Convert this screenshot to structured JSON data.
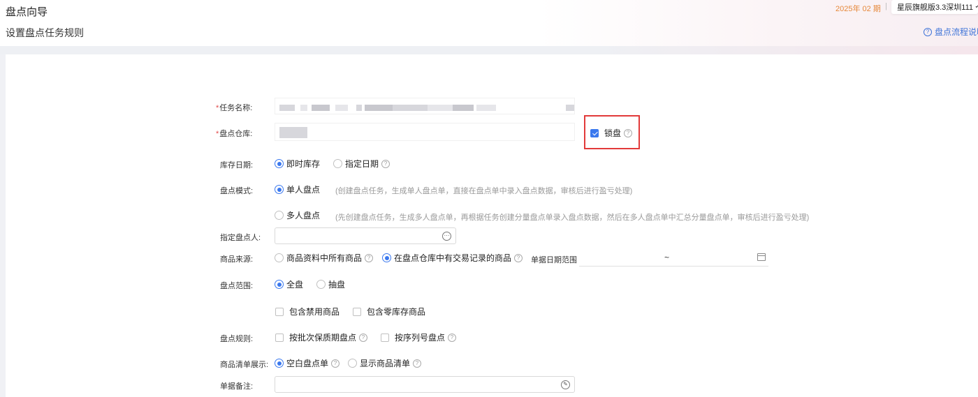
{
  "header": {
    "title": "盘点向导",
    "subtitle": "设置盘点任务规则",
    "period": "2025年 02 期",
    "separator": "|",
    "store": "星辰旗舰版3.3深圳111",
    "help_link": "盘点流程说明"
  },
  "form": {
    "task_name": {
      "label": "任务名称:",
      "required": "*"
    },
    "warehouse": {
      "label": "盘点仓库:",
      "required": "*",
      "lock_label": "锁盘",
      "lock_checked": true
    },
    "stock_date": {
      "label": "库存日期:",
      "options": [
        "即时库存",
        "指定日期"
      ],
      "selected": 0
    },
    "mode": {
      "label": "盘点模式:",
      "single": {
        "label": "单人盘点",
        "hint": "(创建盘点任务，生成单人盘点单，直接在盘点单中录入盘点数据，审核后进行盈亏处理)",
        "selected": true
      },
      "multi": {
        "label": "多人盘点",
        "hint": "(先创建盘点任务，生成多人盘点单，再根据任务创建分量盘点单录入盘点数据，然后在多人盘点单中汇总分量盘点单，审核后进行盈亏处理)",
        "selected": false
      }
    },
    "counter": {
      "label": "指定盘点人:",
      "value": ""
    },
    "source": {
      "label": "商品来源:",
      "options": [
        "商品资料中所有商品",
        "在盘点仓库中有交易记录的商品"
      ],
      "selected": 1,
      "date_range_label": "单据日期范围",
      "date_range_sep": "~"
    },
    "scope": {
      "label": "盘点范围:",
      "options": [
        "全盘",
        "抽盘"
      ],
      "selected": 0,
      "include_disabled": "包含禁用商品",
      "include_zero": "包含零库存商品"
    },
    "rules": {
      "label": "盘点规则:",
      "batch": "按批次保质期盘点",
      "serial": "按序列号盘点"
    },
    "display": {
      "label": "商品清单展示:",
      "options": [
        "空白盘点单",
        "显示商品清单"
      ],
      "selected": 0
    },
    "remark": {
      "label": "单据备注:",
      "value": ""
    }
  },
  "icons": {
    "help": "question-circle-icon",
    "more": "ellipsis-circle-icon",
    "calendar": "calendar-icon",
    "remark": "edit-circle-icon"
  },
  "colors": {
    "accent": "#3a78ee",
    "period": "#e6883a",
    "required": "#e24b4b",
    "highlight": "#e23a3a"
  }
}
